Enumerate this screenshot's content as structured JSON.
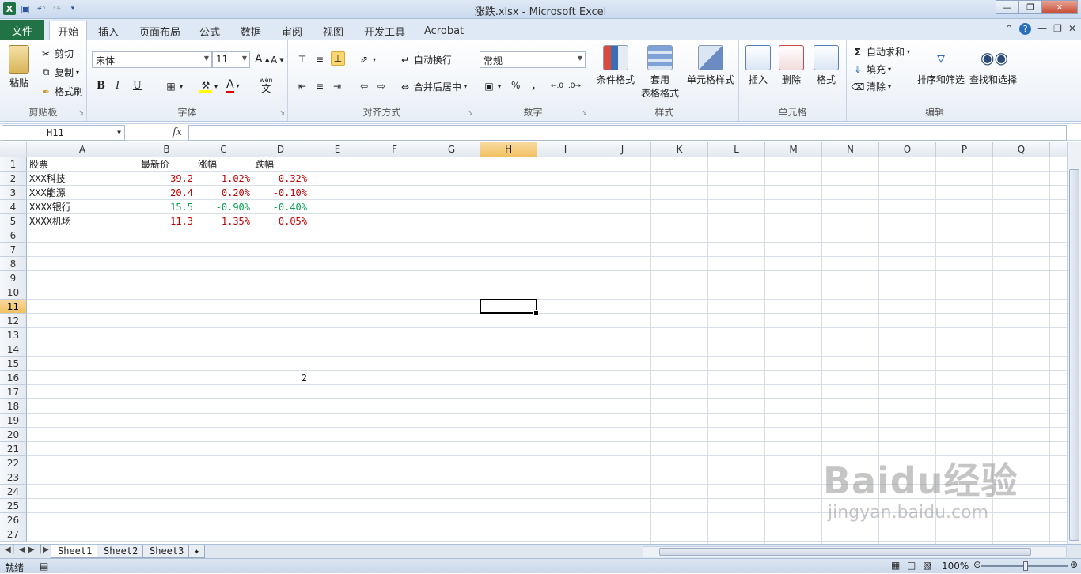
{
  "window": {
    "title": "涨跌.xlsx  -  Microsoft Excel"
  },
  "qat": {
    "logo": "X",
    "save_icon": "save-icon",
    "undo_icon": "undo-icon",
    "redo_icon": "redo-icon"
  },
  "tabs": {
    "file": "文件",
    "items": [
      "开始",
      "插入",
      "页面布局",
      "公式",
      "数据",
      "审阅",
      "视图",
      "开发工具",
      "Acrobat"
    ]
  },
  "ribbon": {
    "clipboard": {
      "label": "剪贴板",
      "paste": "粘贴",
      "cut": "剪切",
      "copy": "复制",
      "painter": "格式刷"
    },
    "font": {
      "label": "字体",
      "name": "宋体",
      "size": "11",
      "bold": "B",
      "italic": "I",
      "underline": "U",
      "grow": "A",
      "shrink": "A",
      "fontcolor": "A",
      "wen": "wén",
      "wen_char": "文"
    },
    "align": {
      "label": "对齐方式",
      "wrap": "自动换行",
      "merge": "合并后居中"
    },
    "number": {
      "label": "数字",
      "format": "常规",
      "percent": "%",
      "comma": ","
    },
    "styles": {
      "label": "样式",
      "cond": "条件格式",
      "table1": "套用",
      "table2": "表格格式",
      "cell": "单元格样式"
    },
    "cells": {
      "label": "单元格",
      "insert": "插入",
      "delete": "删除",
      "format": "格式"
    },
    "editing": {
      "label": "编辑",
      "autosum": "自动求和",
      "fill": "填充",
      "clear": "清除",
      "sort": "排序和筛选",
      "find": "查找和选择"
    }
  },
  "formula": {
    "namebox": "H11",
    "fx": "fx",
    "value": ""
  },
  "columns": [
    "A",
    "B",
    "C",
    "D",
    "E",
    "F",
    "G",
    "H",
    "I",
    "J",
    "K",
    "L",
    "M",
    "N",
    "O",
    "P",
    "Q"
  ],
  "rows": [
    "1",
    "2",
    "3",
    "4",
    "5",
    "6",
    "7",
    "8",
    "9",
    "10",
    "11",
    "12",
    "13",
    "14",
    "15",
    "16",
    "17",
    "18",
    "19",
    "20",
    "21",
    "22",
    "23",
    "24",
    "25",
    "26",
    "27"
  ],
  "cells": {
    "A1": "股票",
    "B1": "最新价",
    "C1": "涨幅",
    "D1": "跌幅",
    "A2": "XXX科技",
    "B2": "39.2",
    "C2": "1.02%",
    "D2": "-0.32%",
    "A3": "XXX能源",
    "B3": "20.4",
    "C3": "0.20%",
    "D3": "-0.10%",
    "A4": "XXXX银行",
    "B4": "15.5",
    "C4": "-0.90%",
    "D4": "-0.40%",
    "A5": "XXXX机场",
    "B5": "11.3",
    "C5": "1.35%",
    "D5": "0.05%",
    "D16": "2"
  },
  "sheets": [
    "Sheet1",
    "Sheet2",
    "Sheet3"
  ],
  "status": {
    "text": "就绪",
    "zoom": "100%"
  },
  "watermark": {
    "line1": "Baidu经验",
    "line2": "jingyan.baidu.com"
  },
  "colors": {
    "accent": "#217346",
    "up": "#c00000",
    "down": "#00a050"
  }
}
